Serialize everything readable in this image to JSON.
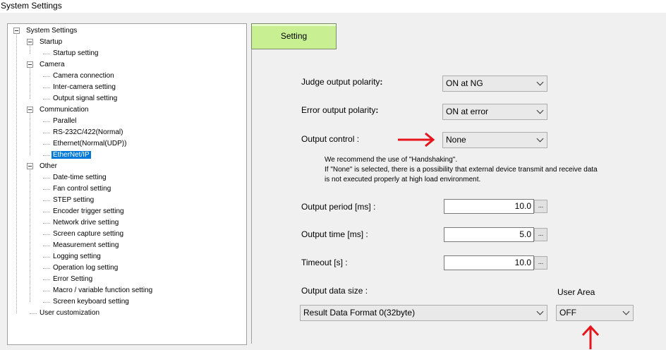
{
  "window": {
    "title": "System Settings"
  },
  "tree": {
    "items": [
      {
        "label": "System Settings",
        "level": 0,
        "expander": true
      },
      {
        "label": "Startup",
        "level": 1,
        "expander": true
      },
      {
        "label": "Startup setting",
        "level": 2
      },
      {
        "label": "Camera",
        "level": 1,
        "expander": true
      },
      {
        "label": "Camera connection",
        "level": 2
      },
      {
        "label": "Inter-camera setting",
        "level": 2
      },
      {
        "label": "Output signal setting",
        "level": 2
      },
      {
        "label": "Communication",
        "level": 1,
        "expander": true
      },
      {
        "label": "Parallel",
        "level": 2
      },
      {
        "label": "RS-232C/422(Normal)",
        "level": 2
      },
      {
        "label": "Ethernet(Normal(UDP))",
        "level": 2
      },
      {
        "label": "EtherNet/IP",
        "level": 2,
        "selected": true
      },
      {
        "label": "Other",
        "level": 1,
        "expander": true
      },
      {
        "label": "Date-time setting",
        "level": 2
      },
      {
        "label": "Fan control setting",
        "level": 2
      },
      {
        "label": "STEP setting",
        "level": 2
      },
      {
        "label": "Encoder trigger setting",
        "level": 2
      },
      {
        "label": "Network drive setting",
        "level": 2
      },
      {
        "label": "Screen capture setting",
        "level": 2
      },
      {
        "label": "Measurement setting",
        "level": 2
      },
      {
        "label": "Logging setting",
        "level": 2
      },
      {
        "label": "Operation log setting",
        "level": 2
      },
      {
        "label": "Error Setting",
        "level": 2
      },
      {
        "label": "Macro / variable function setting",
        "level": 2
      },
      {
        "label": "Screen keyboard setting",
        "level": 2
      },
      {
        "label": "User customization",
        "level": 1
      }
    ]
  },
  "tab": {
    "label": "Setting"
  },
  "form": {
    "judge_output_polarity": {
      "label": "Judge output polarity",
      "colon": ":",
      "value": "ON at NG"
    },
    "error_output_polarity": {
      "label": "Error output polarity",
      "colon": ":",
      "value": "ON at error"
    },
    "output_control": {
      "label": "Output control :",
      "value": "None"
    },
    "note": {
      "line1": "We recommend the use of \"Handshaking\".",
      "line2": "If \"None\" is selected, there is a possibility that external device transmit and receive data",
      "line3": "is not executed properly at high load environment."
    },
    "output_period": {
      "label": "Output period [ms] :",
      "value": "10.0",
      "button": "..."
    },
    "output_time": {
      "label": "Output time [ms] :",
      "value": "5.0",
      "button": "..."
    },
    "timeout": {
      "label": "Timeout [s] :",
      "value": "10.0",
      "button": "..."
    },
    "output_data_size": {
      "label": "Output data size :",
      "value": "Result Data Format 0(32byte)"
    },
    "user_area": {
      "label": "User Area",
      "value": "OFF"
    }
  },
  "colors": {
    "annotation_arrow": "#e8141b",
    "tab_bg": "#c8f093",
    "selection": "#0078d7"
  },
  "annotations": [
    {
      "icon": "red-arrow-right-icon"
    },
    {
      "icon": "red-arrow-up-icon"
    }
  ]
}
